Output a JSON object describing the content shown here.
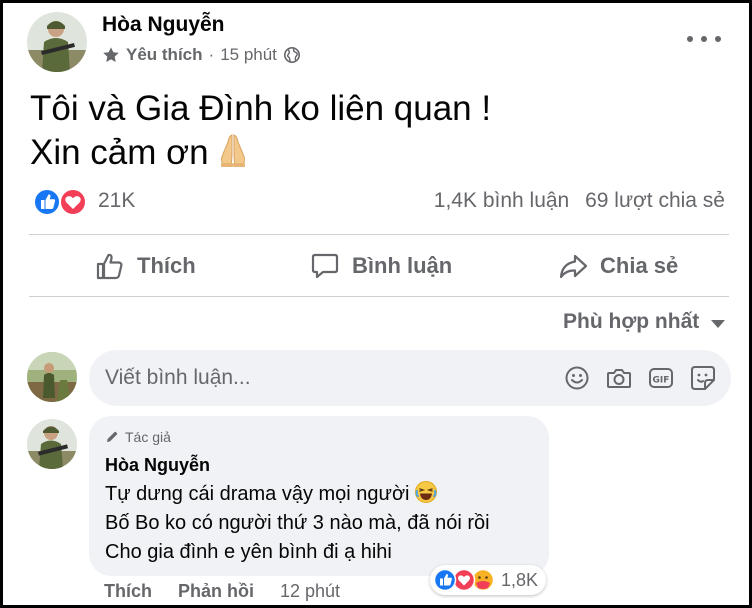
{
  "post": {
    "author": "Hòa Nguyễn",
    "audience_label": "Yêu thích",
    "separator": "·",
    "time": "15 phút",
    "text_lines": [
      "Tôi và Gia Đình ko liên quan !",
      "Xin cảm ơn"
    ],
    "text_emoji": "pray-emoji"
  },
  "reactions": {
    "icons": [
      "like-icon",
      "love-icon"
    ],
    "count": "21K",
    "comments": "1,4K bình luận",
    "shares": "69 lượt chia sẻ"
  },
  "actions": {
    "like": "Thích",
    "comment": "Bình luận",
    "share": "Chia sẻ"
  },
  "sort": {
    "label": "Phù hợp nhất"
  },
  "composer": {
    "placeholder": "Viết bình luận...",
    "tools": [
      "emoji-icon",
      "camera-icon",
      "gif-icon",
      "sticker-icon"
    ]
  },
  "comment": {
    "badge": "Tác giả",
    "author": "Hòa Nguyễn",
    "lines": [
      "Tự dưng cái drama vậy mọi người",
      "Bố Bo ko có người thứ 3 nào mà, đã nói rồi",
      "Cho gia đình e yên bình đi ạ hihi"
    ],
    "reaction_icons": [
      "like-icon",
      "love-icon",
      "care-icon"
    ],
    "reaction_count": "1,8K",
    "like_label": "Thích",
    "reply_label": "Phản hồi",
    "time": "12 phút"
  },
  "colors": {
    "text_primary": "#050505",
    "text_secondary": "#65676b",
    "like_blue": "#1877f2",
    "love_red": "#f33e58",
    "care_yellow": "#f7b125",
    "divider": "#ced0d4",
    "bubble_bg": "#f0f2f5"
  }
}
